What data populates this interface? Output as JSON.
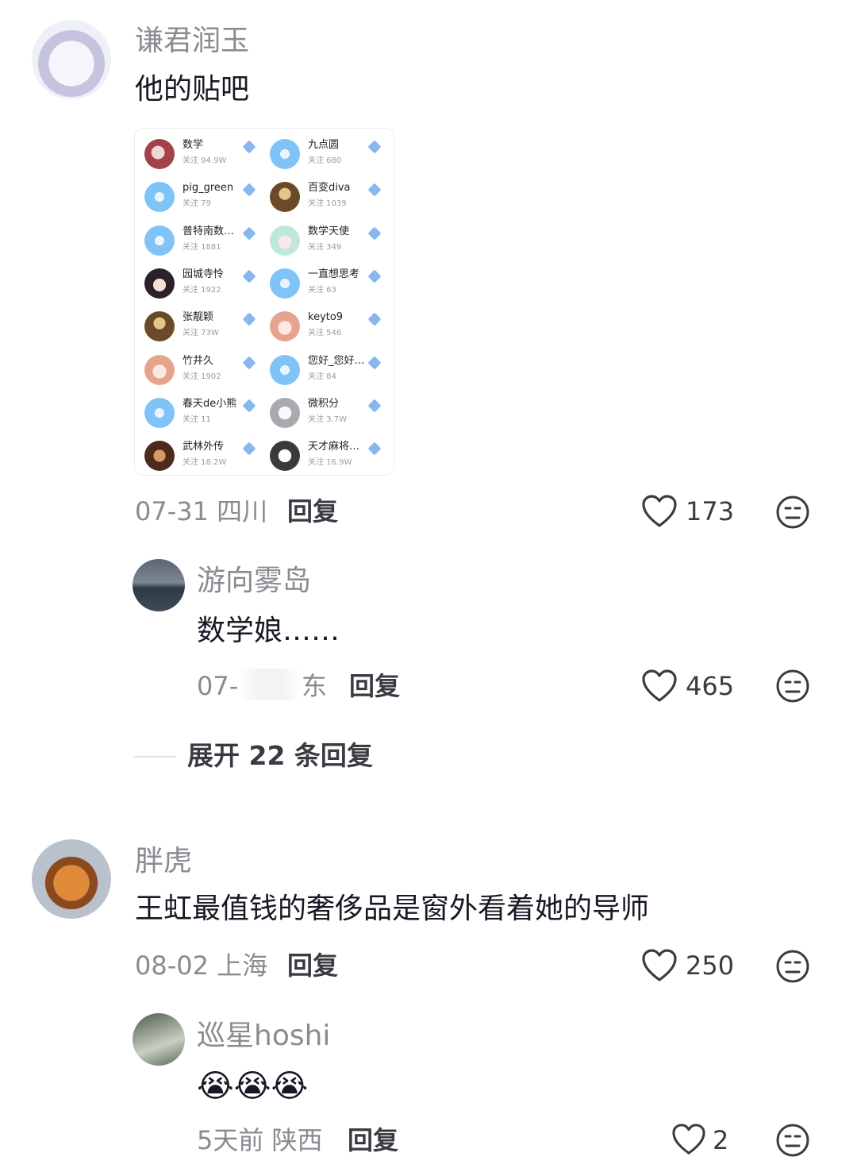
{
  "comments": [
    {
      "username": "谦君润玉",
      "text": "他的贴吧",
      "date_location": "07-31 四川",
      "reply_label": "回复",
      "likes": "173",
      "avatar_icon": "anime-girl-avatar",
      "attachment": {
        "items": [
          {
            "name": "数学",
            "follow": "关注 94.9W",
            "icon": "ico-red"
          },
          {
            "name": "九点圆",
            "follow": "关注 680",
            "icon": "ico-blue"
          },
          {
            "name": "pig_green",
            "follow": "关注 79",
            "icon": "ico-blue"
          },
          {
            "name": "百变diva",
            "follow": "关注 1039",
            "icon": "ico-gold"
          },
          {
            "name": "普特南数…",
            "follow": "关注 1881",
            "icon": "ico-blue"
          },
          {
            "name": "数学天使",
            "follow": "关注 349",
            "icon": "ico-mint"
          },
          {
            "name": "园城寺怜",
            "follow": "关注 1922",
            "icon": "ico-dark"
          },
          {
            "name": "一直想思考",
            "follow": "关注 63",
            "icon": "ico-blue"
          },
          {
            "name": "张靓颖",
            "follow": "关注 73W",
            "icon": "ico-gold"
          },
          {
            "name": "keyto9",
            "follow": "关注 546",
            "icon": "ico-pink"
          },
          {
            "name": "竹井久",
            "follow": "关注 1902",
            "icon": "ico-pink"
          },
          {
            "name": "您好_您好…",
            "follow": "关注 84",
            "icon": "ico-blue"
          },
          {
            "name": "春天de小熊",
            "follow": "关注 11",
            "icon": "ico-blue"
          },
          {
            "name": "微积分",
            "follow": "关注 3.7W",
            "icon": "ico-gray"
          },
          {
            "name": "武林外传",
            "follow": "关注 18.2W",
            "icon": "ico-crowd"
          },
          {
            "name": "天才麻将…",
            "follow": "关注 16.9W",
            "icon": "ico-manga"
          }
        ]
      },
      "replies": [
        {
          "username": "游向雾岛",
          "text": "数学娘……",
          "date_prefix": "07-",
          "date_suffix": "东",
          "reply_label": "回复",
          "likes": "465",
          "avatar_icon": "lake-avatar"
        }
      ],
      "expand_label": "展开 22 条回复"
    },
    {
      "username": "胖虎",
      "text": "王虹最值钱的奢侈品是窗外看着她的导师",
      "date_location": "08-02 上海",
      "reply_label": "回复",
      "likes": "250",
      "avatar_icon": "tiger-avatar",
      "replies": [
        {
          "username": "巡星hoshi",
          "text": "😭😭😭",
          "date_location": "5天前 陕西",
          "reply_label": "回复",
          "likes": "2",
          "avatar_icon": "tree-avatar"
        }
      ]
    }
  ],
  "colors": {
    "username": "#8a8b91",
    "text": "#161823",
    "icon": "#3a3b42"
  }
}
